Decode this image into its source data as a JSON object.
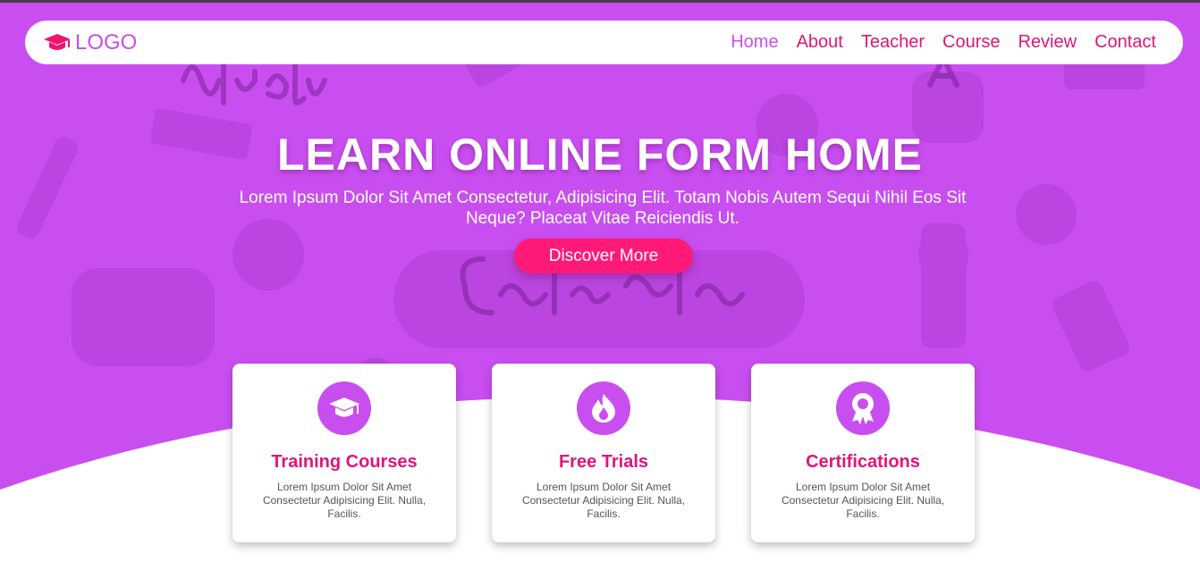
{
  "nav": {
    "logo_text": "LOGO",
    "links": [
      "Home",
      "About",
      "Teacher",
      "Course",
      "Review",
      "Contact"
    ],
    "active": "Home"
  },
  "hero": {
    "title": "LEARN ONLINE FORM HOME",
    "subtitle": "Lorem Ipsum Dolor Sit Amet Consectetur, Adipisicing Elit. Totam Nobis Autem Sequi Nihil Eos Sit Neque? Placeat Vitae Reiciendis Ut.",
    "button_label": "Discover More",
    "background_words": [
      "Study",
      "Education"
    ]
  },
  "features": [
    {
      "icon": "graduation-cap-icon",
      "title": "Training Courses",
      "text": "Lorem Ipsum Dolor Sit Amet Consectetur Adipisicing Elit. Nulla, Facilis."
    },
    {
      "icon": "fire-icon",
      "title": "Free Trials",
      "text": "Lorem Ipsum Dolor Sit Amet Consectetur Adipisicing Elit. Nulla, Facilis."
    },
    {
      "icon": "award-icon",
      "title": "Certifications",
      "text": "Lorem Ipsum Dolor Sit Amet Consectetur Adipisicing Elit. Nulla, Facilis."
    }
  ],
  "colors": {
    "primary": "#c94ef0",
    "accent": "#ff1a78",
    "link": "#e0157a"
  }
}
